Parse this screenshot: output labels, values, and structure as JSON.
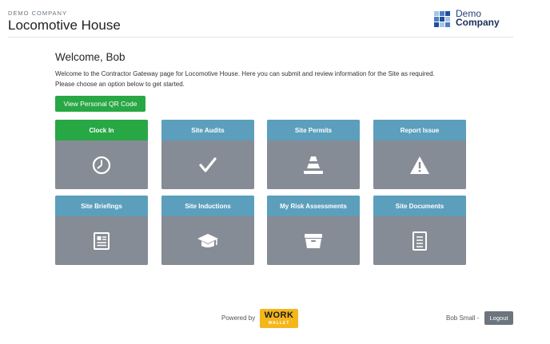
{
  "header": {
    "company": "DEMO COMPANY",
    "site_name": "Locomotive House",
    "logo_line1": "Demo",
    "logo_line2": "Company"
  },
  "welcome": {
    "title": "Welcome, Bob",
    "line1": "Welcome to the Contractor Gateway page for Locomotive House. Here you can submit and review information for the Site as required.",
    "line2": "Please choose an option below to get started."
  },
  "qr_button": "View Personal QR Code",
  "tiles": [
    {
      "label": "Clock In",
      "icon": "clock-icon",
      "color": "#28a745"
    },
    {
      "label": "Site Audits",
      "icon": "checkmark-icon",
      "color": "#5b9fbd"
    },
    {
      "label": "Site Permits",
      "icon": "traffic-cone-icon",
      "color": "#5b9fbd"
    },
    {
      "label": "Report Issue",
      "icon": "warning-icon",
      "color": "#5b9fbd"
    },
    {
      "label": "Site Briefings",
      "icon": "newspaper-icon",
      "color": "#5b9fbd"
    },
    {
      "label": "Site Inductions",
      "icon": "graduation-cap-icon",
      "color": "#5b9fbd"
    },
    {
      "label": "My Risk Assessments",
      "icon": "archive-icon",
      "color": "#5b9fbd"
    },
    {
      "label": "Site Documents",
      "icon": "document-icon",
      "color": "#5b9fbd"
    }
  ],
  "footer": {
    "powered_by": "Powered by",
    "brand_line1": "WORK",
    "brand_line2": "WALLET",
    "user": "Bob Small -",
    "logout": "Logout"
  },
  "colors": {
    "green": "#28a745",
    "blue_header": "#5b9fbd",
    "tile_body": "#868c95",
    "logout": "#6c757d",
    "workwallet_yellow": "#f4b61a"
  }
}
